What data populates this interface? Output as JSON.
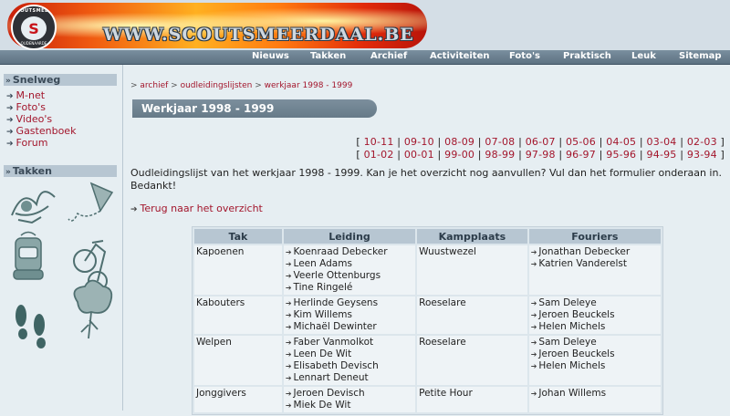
{
  "header": {
    "site_title": "WWW.SCOUTSMEERDAAL.BE",
    "logo_top_text": "SCOUTSMEERDAAL",
    "logo_bottom_text": "OUDENAARDE",
    "logo_mark": "S"
  },
  "nav": {
    "items": [
      "Nieuws",
      "Takken",
      "Archief",
      "Activiteiten",
      "Foto's",
      "Praktisch",
      "Leuk",
      "Sitemap"
    ]
  },
  "sidebar": {
    "snelweg_heading": "Snelweg",
    "snelweg_links": [
      "M-net",
      "Foto's",
      "Video's",
      "Gastenboek",
      "Forum"
    ],
    "takken_heading": "Takken"
  },
  "breadcrumb": {
    "items": [
      "archief",
      "oudleidingslijsten",
      "werkjaar 1998 - 1999"
    ]
  },
  "page": {
    "title": "Werkjaar 1998 - 1999",
    "years_row1": [
      "10-11",
      "09-10",
      "08-09",
      "07-08",
      "06-07",
      "05-06",
      "04-05",
      "03-04",
      "02-03"
    ],
    "years_row2": [
      "01-02",
      "00-01",
      "99-00",
      "98-99",
      "97-98",
      "96-97",
      "95-96",
      "94-95",
      "93-94"
    ],
    "intro": "Oudleidingslijst van het werkjaar 1998 - 1999. Kan je het overzicht nog aanvullen? Vul dan het formulier onderaan in. Bedankt!",
    "back_link": "Terug naar het overzicht"
  },
  "table": {
    "headers": [
      "Tak",
      "Leiding",
      "Kampplaats",
      "Fouriers"
    ],
    "rows": [
      {
        "tak": "Kapoenen",
        "leiding": [
          "Koenraad Debecker",
          "Leen Adams",
          "Veerle Ottenburgs",
          "Tine Ringelé"
        ],
        "kampplaats": "Wuustwezel",
        "fouriers": [
          "Jonathan Debecker",
          "Katrien Vanderelst"
        ]
      },
      {
        "tak": "Kabouters",
        "leiding": [
          "Herlinde Geysens",
          "Kim Willems",
          "Michaël Dewinter"
        ],
        "kampplaats": "Roeselare",
        "fouriers": [
          "Sam Deleye",
          "Jeroen Beuckels",
          "Helen Michels"
        ]
      },
      {
        "tak": "Welpen",
        "leiding": [
          "Faber Vanmolkot",
          "Leen De Wit",
          "Elisabeth Devisch",
          "Lennart Deneut"
        ],
        "kampplaats": "Roeselare",
        "fouriers": [
          "Sam Deleye",
          "Jeroen Beuckels",
          "Helen Michels"
        ]
      },
      {
        "tak": "Jonggivers",
        "leiding": [
          "Jeroen Devisch",
          "Miek De Wit"
        ],
        "kampplaats": "Petite Hour",
        "fouriers": [
          "Johan Willems"
        ]
      }
    ]
  },
  "colors": {
    "link": "#a3162c",
    "nav_bar": "#6b7f8e",
    "heading_bg": "#b7c6d2",
    "page_bg": "#e6eef2"
  }
}
